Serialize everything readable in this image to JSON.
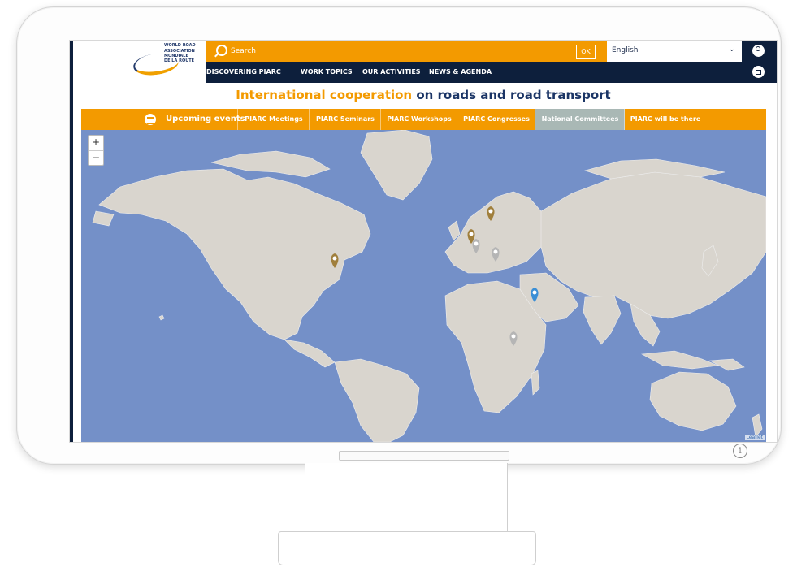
{
  "header": {
    "logo_lines": [
      "WORLD ROAD",
      "ASSOCIATION",
      "MONDIALE",
      "DE LA ROUTE"
    ],
    "search_placeholder": "Search",
    "ok_label": "OK",
    "language": "English",
    "nav": [
      "DISCOVERING PIARC",
      "WORK TOPICS",
      "OUR ACTIVITIES",
      "NEWS & AGENDA"
    ]
  },
  "headline": {
    "part1": "International cooperation",
    "part2": " on roads and road transport"
  },
  "events": {
    "title": "Upcoming events",
    "tabs": [
      "PIARC Meetings",
      "PIARC Seminars",
      "PIARC Workshops",
      "PIARC Congresses",
      "National Committees",
      "PIARC will be there"
    ],
    "active_tab": "National Committees"
  },
  "map": {
    "zoom_in": "+",
    "zoom_out": "−",
    "attribution": "Leaflet",
    "colors": {
      "ocean": "#7490c8",
      "land": "#d9d5ce",
      "marker_gold": "#a07f3c",
      "marker_grey": "#b5b5b5",
      "marker_blue": "#3b8fd6"
    }
  },
  "icons": {
    "search": "search-icon",
    "user": "user-icon",
    "bag": "bag-icon",
    "calendar": "calendar-icon",
    "info": "info-icon"
  }
}
